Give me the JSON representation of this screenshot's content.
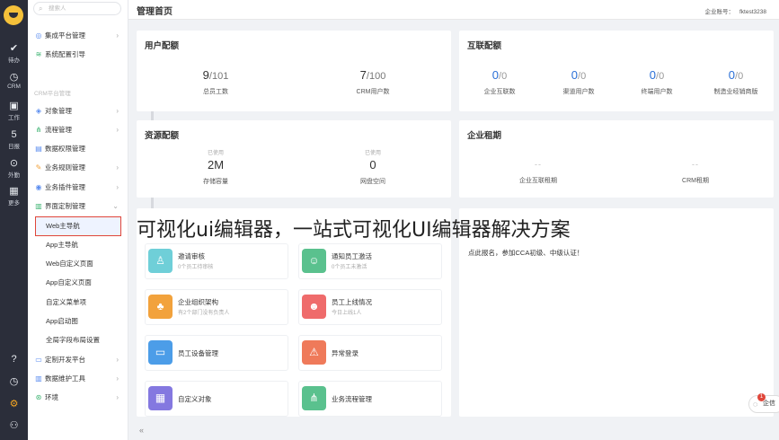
{
  "rail": {
    "items": [
      {
        "icon": "check-circle-icon",
        "glyph": "✔",
        "label": "待办"
      },
      {
        "icon": "clock-icon",
        "glyph": "◷",
        "label": "CRM"
      },
      {
        "icon": "briefcase-icon",
        "glyph": "▣",
        "label": "工作"
      },
      {
        "icon": "calendar-icon",
        "glyph": "5",
        "label": "日报"
      },
      {
        "icon": "location-icon",
        "glyph": "⊙",
        "label": "外勤"
      },
      {
        "icon": "grid-icon",
        "glyph": "▦",
        "label": "更多"
      }
    ],
    "bottom": [
      {
        "icon": "help-icon",
        "glyph": "?"
      },
      {
        "icon": "history-icon",
        "glyph": "◷"
      },
      {
        "icon": "gear-icon",
        "glyph": "⚙"
      },
      {
        "icon": "user-switch-icon",
        "glyph": "⚇"
      }
    ]
  },
  "sidebar": {
    "search_placeholder": "搜索人",
    "groups": {
      "crm": "CRM平台管理"
    },
    "top_items": [
      {
        "icon": "integration-icon",
        "glyph": "◎",
        "label": "集成平台管理"
      },
      {
        "icon": "wifi-icon",
        "glyph": "≋",
        "label": "系统配置引导"
      }
    ],
    "items": [
      {
        "icon": "object-icon",
        "glyph": "◈",
        "label": "对象管理"
      },
      {
        "icon": "flow-icon",
        "glyph": "⋔",
        "label": "流程管理"
      },
      {
        "icon": "permission-icon",
        "glyph": "▤",
        "label": "数据权限管理"
      },
      {
        "icon": "rule-icon",
        "glyph": "✎",
        "label": "业务规则管理"
      },
      {
        "icon": "plugin-icon",
        "glyph": "◉",
        "label": "业务插件管理"
      },
      {
        "icon": "layout-icon",
        "glyph": "▥",
        "label": "界面定制管理"
      }
    ],
    "children": [
      {
        "label": "Web主导航",
        "active": true
      },
      {
        "label": "App主导航"
      },
      {
        "label": "Web自定义页面"
      },
      {
        "label": "App自定义页面"
      },
      {
        "label": "自定义菜单项"
      },
      {
        "label": "App启动图"
      },
      {
        "label": "全局字段布局设置"
      }
    ],
    "bottom_items": [
      {
        "icon": "dev-platform-icon",
        "glyph": "▭",
        "label": "定制开发平台"
      },
      {
        "icon": "chart-icon",
        "glyph": "▥",
        "label": "数据维护工具"
      },
      {
        "icon": "env-icon",
        "glyph": "⊛",
        "label": "环境"
      }
    ],
    "collapse_glyph": "«"
  },
  "header": {
    "title": "管理首页",
    "account_label": "企业账号：",
    "account_value": "fktest3238"
  },
  "user_quota": {
    "title": "用户配额",
    "stats": [
      {
        "used": "9",
        "total": "/101",
        "label": "总员工数"
      },
      {
        "used": "7",
        "total": "/100",
        "label": "CRM用户数"
      }
    ]
  },
  "interconnect_quota": {
    "title": "互联配额",
    "stats": [
      {
        "used": "0",
        "total": "/0",
        "label": "企业互联数"
      },
      {
        "used": "0",
        "total": "/0",
        "label": "渠道用户数"
      },
      {
        "used": "0",
        "total": "/0",
        "label": "终端用户数"
      },
      {
        "used": "0",
        "total": "/0",
        "label": "制造业经销商版"
      }
    ]
  },
  "resource_quota": {
    "title": "资源配额",
    "stats": [
      {
        "caption": "已使用",
        "value": "2M",
        "label": "存储容量"
      },
      {
        "caption": "已使用",
        "value": "0",
        "label": "网盘空间"
      }
    ]
  },
  "enterprise_lease": {
    "title": "企业租期",
    "stats": [
      {
        "value": "--",
        "label": "企业互联租期"
      },
      {
        "value": "--",
        "label": "CRM租期"
      }
    ]
  },
  "shortcuts": [
    {
      "icon": "stamp-icon",
      "glyph": "♙",
      "color": "#6fcfd8",
      "name": "邀请审核",
      "sub": "0个员工待审核"
    },
    {
      "icon": "user-add-icon",
      "glyph": "☺",
      "color": "#5ac18e",
      "name": "通知员工激活",
      "sub": "0个员工未激活"
    },
    {
      "icon": "org-chart-icon",
      "glyph": "♣",
      "color": "#f2a23c",
      "name": "企业组织架构",
      "sub": "有2个部门没有负责人"
    },
    {
      "icon": "staff-online-icon",
      "glyph": "☻",
      "color": "#ef6b6b",
      "name": "员工上线情况",
      "sub": "今日上线1人"
    },
    {
      "icon": "monitor-icon",
      "glyph": "▭",
      "color": "#4c9de8",
      "name": "员工设备管理",
      "sub": ""
    },
    {
      "icon": "warning-icon",
      "glyph": "⚠",
      "color": "#ef7a5a",
      "name": "异常登录",
      "sub": ""
    },
    {
      "icon": "custom-object-icon",
      "glyph": "▦",
      "color": "#8478e0",
      "name": "自定义对象",
      "sub": ""
    },
    {
      "icon": "workflow-icon",
      "glyph": "⋔",
      "color": "#5ac18e",
      "name": "业务流程管理",
      "sub": ""
    }
  ],
  "notice": "点此报名，参加CCA初级、中级认证！",
  "overlay_text": "可视化ui编辑器，一站式可视化UI编辑器解决方案",
  "float_button": {
    "label": "企信",
    "badge": "1"
  }
}
